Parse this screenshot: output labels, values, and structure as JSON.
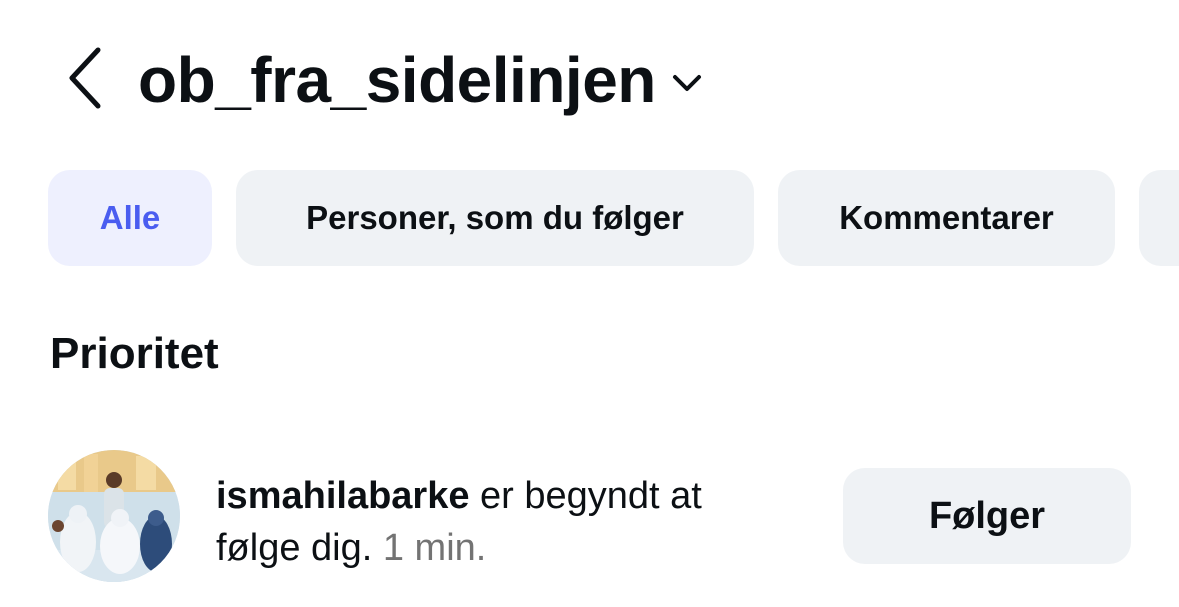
{
  "header": {
    "username": "ob_fra_sidelinjen",
    "back_icon": "chevron-left-icon",
    "dropdown_icon": "chevron-down-icon"
  },
  "filters": {
    "items": [
      {
        "label": "Alle",
        "active": true
      },
      {
        "label": "Personer, som du følger",
        "active": false
      },
      {
        "label": "Kommentarer",
        "active": false
      },
      {
        "label": "",
        "active": false
      }
    ],
    "active_color": "#4a5df0",
    "active_bg": "#eef0fe",
    "chip_bg": "#eff2f5"
  },
  "section": {
    "title": "Prioritet"
  },
  "notifications": [
    {
      "username": "ismahilabarke",
      "message_part1": " er begyndt at",
      "message_part2": "følge dig.",
      "time": " 1 min.",
      "button_label": "Følger"
    }
  ]
}
